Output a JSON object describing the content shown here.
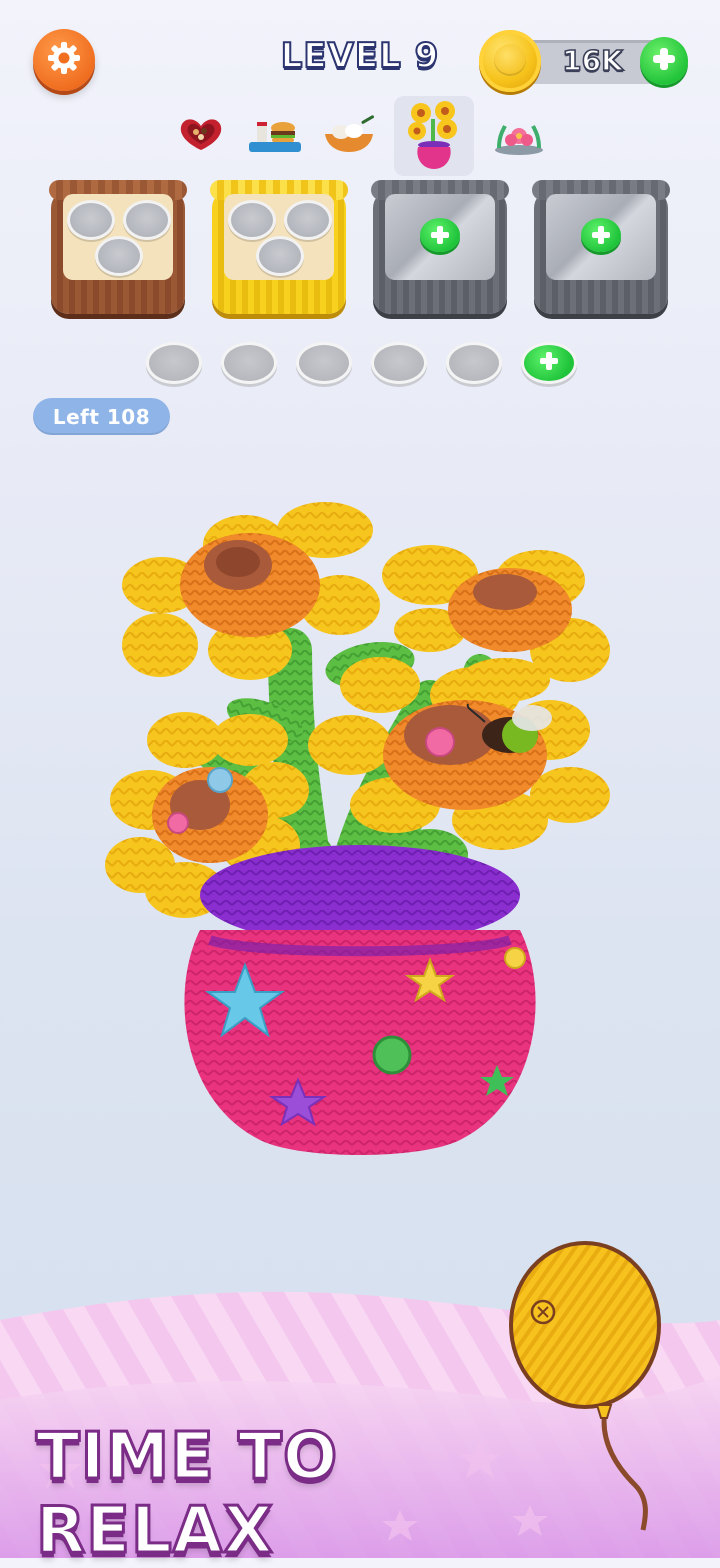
{
  "header": {
    "level_label": "LEVEL 9",
    "coins": "16K",
    "settings_icon": "gear-icon",
    "coin_icon": "coin-icon",
    "add_coins_icon": "plus-icon"
  },
  "collection": {
    "items": [
      {
        "name": "heart-chocolate-box"
      },
      {
        "name": "burger-meal-tray"
      },
      {
        "name": "dumpling-bowl"
      },
      {
        "name": "sunflower-vase",
        "active": true
      },
      {
        "name": "pink-flower-pot"
      }
    ]
  },
  "baskets": [
    {
      "color": "brown",
      "state": "open",
      "slots": 3
    },
    {
      "color": "yellow",
      "state": "open",
      "slots": 3
    },
    {
      "color": "gray",
      "state": "locked"
    },
    {
      "color": "gray",
      "state": "locked"
    }
  ],
  "holding_pads": {
    "empty_count": 5,
    "add_button": true
  },
  "status": {
    "left_label": "Left 108"
  },
  "banner": {
    "text": "TIME TO RELAX"
  },
  "colors": {
    "accent_orange": "#f06e20",
    "accent_green": "#22c43a",
    "banner_purple": "#7a2c86",
    "left_pill_blue": "#8fb4e8"
  }
}
